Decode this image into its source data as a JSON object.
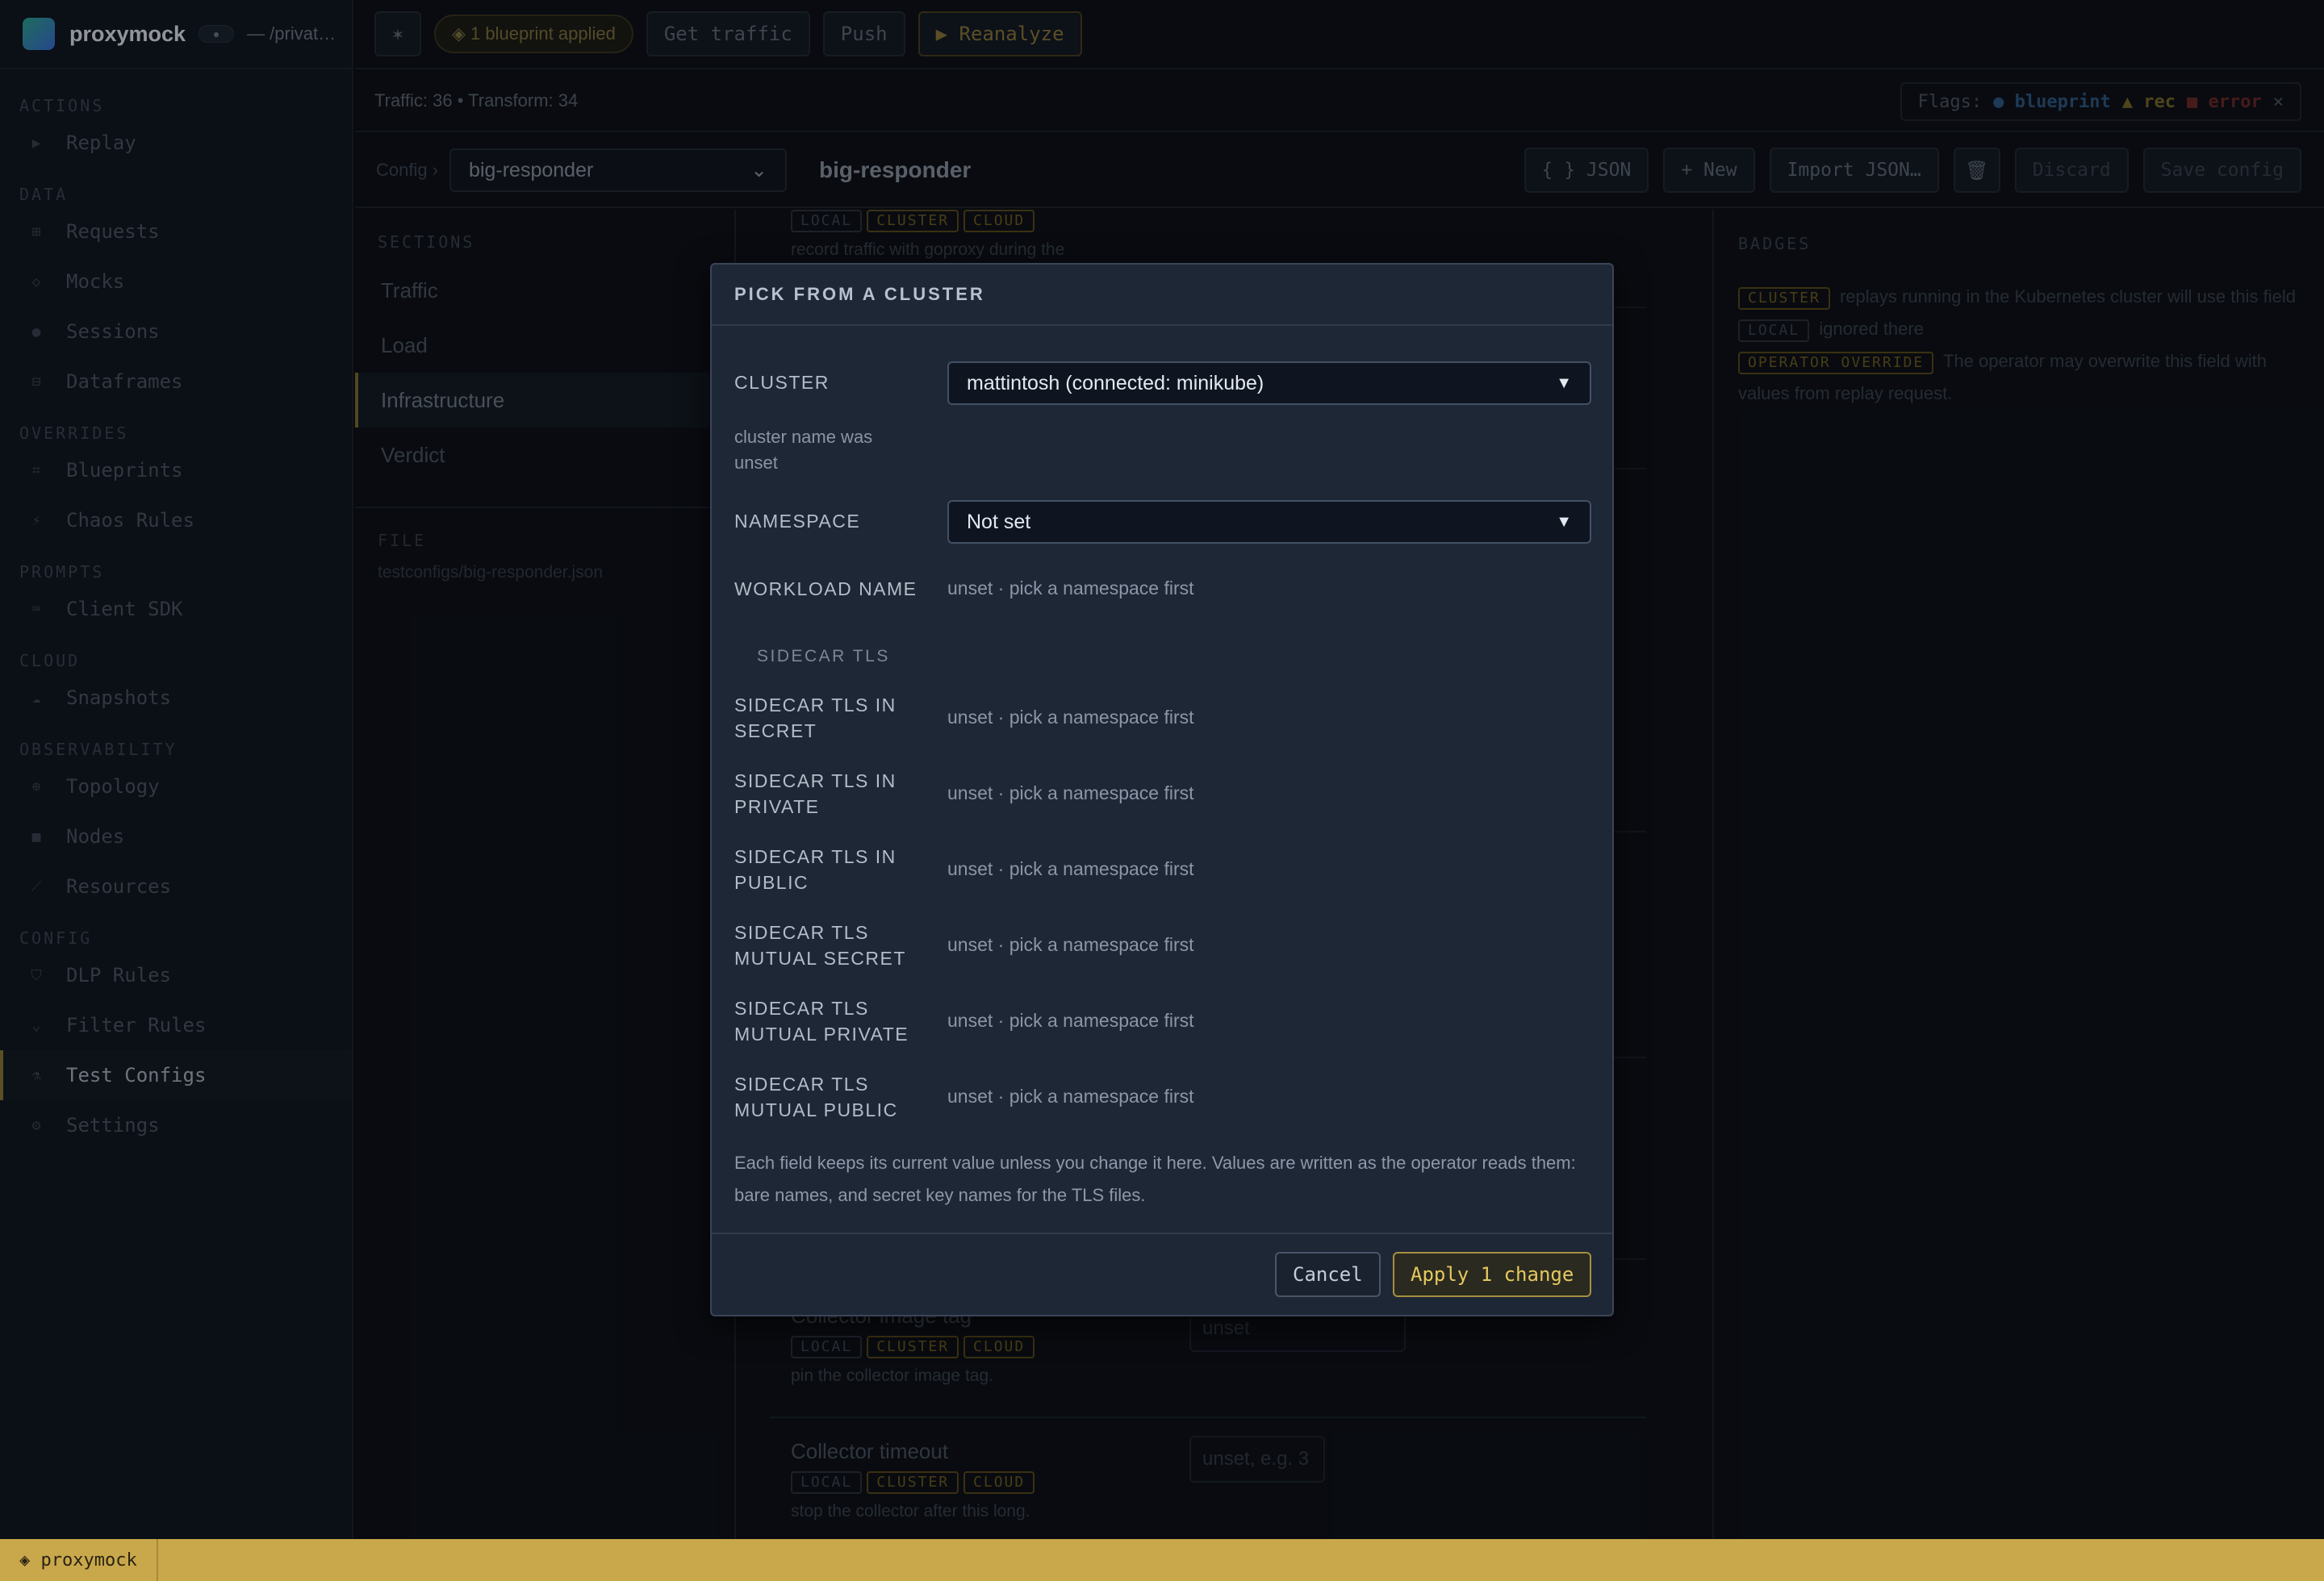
{
  "app": {
    "name": "proxymock",
    "path": "— /privat…",
    "pill": "●"
  },
  "sidebar": {
    "groups": [
      {
        "heading": "ACTIONS",
        "items": [
          {
            "label": "Replay",
            "icon": "play-icon",
            "glyph": "▶"
          }
        ]
      },
      {
        "heading": "DATA",
        "items": [
          {
            "label": "Requests",
            "icon": "grid-icon",
            "glyph": "⊞"
          },
          {
            "label": "Mocks",
            "icon": "diamond-icon",
            "glyph": "◇"
          },
          {
            "label": "Sessions",
            "icon": "dot-icon",
            "glyph": "●"
          },
          {
            "label": "Dataframes",
            "icon": "table-icon",
            "glyph": "⊟"
          }
        ]
      },
      {
        "heading": "OVERRIDES",
        "items": [
          {
            "label": "Blueprints",
            "icon": "blueprint-icon",
            "glyph": "⌗"
          },
          {
            "label": "Chaos Rules",
            "icon": "bolt-icon",
            "glyph": "⚡"
          }
        ]
      },
      {
        "heading": "PROMPTS",
        "items": [
          {
            "label": "Client SDK",
            "icon": "code-icon",
            "glyph": "⌨"
          }
        ]
      },
      {
        "heading": "CLOUD",
        "items": [
          {
            "label": "Snapshots",
            "icon": "cloud-icon",
            "glyph": "☁"
          }
        ]
      },
      {
        "heading": "OBSERVABILITY",
        "items": [
          {
            "label": "Topology",
            "icon": "topology-icon",
            "glyph": "⊕"
          },
          {
            "label": "Nodes",
            "icon": "node-icon",
            "glyph": "■"
          },
          {
            "label": "Resources",
            "icon": "resources-icon",
            "glyph": "⟋"
          }
        ]
      },
      {
        "heading": "CONFIG",
        "items": [
          {
            "label": "DLP Rules",
            "icon": "shield-icon",
            "glyph": "⛉"
          },
          {
            "label": "Filter Rules",
            "icon": "filter-icon",
            "glyph": "⌄"
          },
          {
            "label": "Test Configs",
            "icon": "flask-icon",
            "glyph": "⚗"
          },
          {
            "label": "Settings",
            "icon": "gear-icon",
            "glyph": "⚙"
          }
        ]
      }
    ]
  },
  "topbar": {
    "star": "✶",
    "blueprint_pill": "◈ 1 blueprint applied",
    "get_traffic": "Get traffic",
    "push": "Push",
    "reanalyze": "▶ Reanalyze"
  },
  "subbar": {
    "stats": "Traffic: 36 • Transform: 34",
    "flags_label": "Flags:",
    "flag_blueprint": "● blueprint",
    "flag_rec": "▲ rec",
    "flag_error": "■ error",
    "close": "×"
  },
  "configrow": {
    "label": "Config ›",
    "selected": "big-responder",
    "title": "big-responder",
    "json": "{ } JSON",
    "new": "+ New",
    "import": "Import JSON…",
    "trash": "🗑",
    "discard": "Discard",
    "save": "Save config"
  },
  "sections": {
    "heading": "SECTIONS",
    "items": [
      "Traffic",
      "Load",
      "Infrastructure",
      "Verdict"
    ],
    "file_heading": "FILE",
    "file_path": "testconfigs/big-responder.json"
  },
  "content": {
    "top_desc": "record traffic with goproxy during the",
    "badges": {
      "local": "LOCAL",
      "cluster": "CLUSTER",
      "cloud": "CLOUD"
    },
    "collector_image": {
      "title": "Collector image tag",
      "desc": "pin the collector image tag.",
      "input": "unset"
    },
    "collector_timeout": {
      "title": "Collector timeout",
      "desc": "stop the collector after this long.",
      "input": "unset, e.g. 3"
    }
  },
  "badges_col": {
    "heading": "BADGES",
    "cluster_badge": "CLUSTER",
    "cluster_text": "replays running in the Kubernetes cluster will use this field",
    "local_badge": "LOCAL",
    "local_text": "ignored there",
    "op_badge": "OPERATOR OVERRIDE",
    "op_text": "The operator may overwrite this field with values from replay request."
  },
  "footer": {
    "tag": "◈ proxymock"
  },
  "modal": {
    "title": "PICK FROM A CLUSTER",
    "cluster_label": "CLUSTER",
    "cluster_value": "mattintosh (connected: minikube)",
    "cluster_help": "cluster name was unset",
    "namespace_label": "NAMESPACE",
    "namespace_value": "Not set",
    "workload_label": "WORKLOAD NAME",
    "unset_hint": "unset · pick a namespace first",
    "sidecar_heading": "SIDECAR TLS",
    "tls_rows": [
      "SIDECAR TLS IN SECRET",
      "SIDECAR TLS IN PRIVATE",
      "SIDECAR TLS IN PUBLIC",
      "SIDECAR TLS MUTUAL SECRET",
      "SIDECAR TLS MUTUAL PRIVATE",
      "SIDECAR TLS MUTUAL PUBLIC"
    ],
    "note": "Each field keeps its current value unless you change it here. Values are written as the operator reads them: bare names, and secret key names for the TLS files.",
    "cancel": "Cancel",
    "apply": "Apply 1 change"
  }
}
